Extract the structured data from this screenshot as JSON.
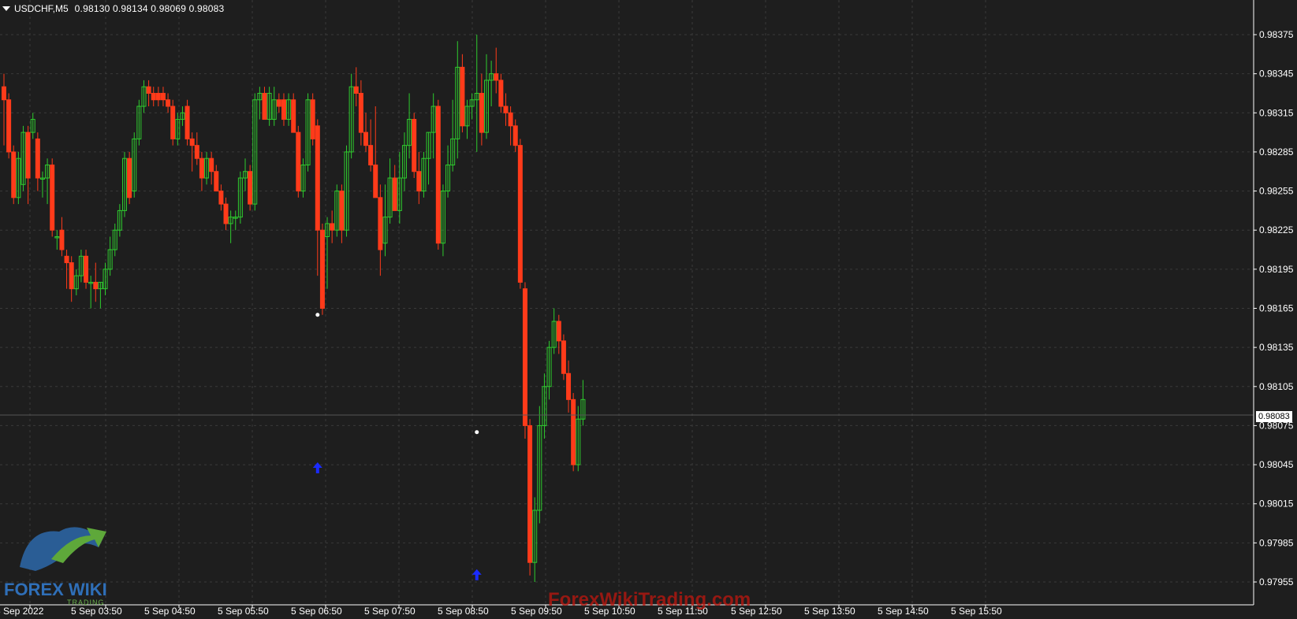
{
  "header": {
    "symbol": "USDCHF,M5",
    "quote": "0.98130 0.98134 0.98069 0.98083"
  },
  "price_axis": {
    "labels": [
      "0.98375",
      "0.98345",
      "0.98315",
      "0.98285",
      "0.98255",
      "0.98225",
      "0.98195",
      "0.98165",
      "0.98135",
      "0.98105",
      "0.98075",
      "0.98045",
      "0.98015",
      "0.97985",
      "0.97955"
    ],
    "current_price": "0.98083"
  },
  "time_axis": {
    "labels": [
      "5 Sep 2022",
      "5 Sep 03:50",
      "5 Sep 04:50",
      "5 Sep 05:50",
      "5 Sep 06:50",
      "5 Sep 07:50",
      "5 Sep 08:50",
      "5 Sep 09:50",
      "5 Sep 10:50",
      "5 Sep 11:50",
      "5 Sep 12:50",
      "5 Sep 13:50",
      "5 Sep 14:50",
      "5 Sep 15:50"
    ]
  },
  "colors": {
    "background": "#1e1e1e",
    "grid": "#3a3a3a",
    "bull": "#2ecc2e",
    "bear": "#ff3b1a",
    "axis_text": "#ffffff",
    "signal_arrow": "#1a2bff"
  },
  "watermark": "ForexWikiTrading.com",
  "logo": {
    "text": "FOREX WIKI",
    "sub": "TRADING"
  },
  "signals": [
    {
      "type": "arrow-up",
      "bar_index": 65,
      "price": 0.98042
    },
    {
      "type": "arrow-up",
      "bar_index": 98,
      "price": 0.9796
    }
  ],
  "dots": [
    {
      "bar_index": 65,
      "price": 0.9816
    },
    {
      "bar_index": 98,
      "price": 0.9807
    }
  ],
  "candles": [
    [
      0.98335,
      0.98345,
      0.9829,
      0.98325
    ],
    [
      0.98325,
      0.9833,
      0.9828,
      0.98285
    ],
    [
      0.98285,
      0.9829,
      0.98245,
      0.9825
    ],
    [
      0.9825,
      0.98285,
      0.98245,
      0.9828
    ],
    [
      0.9826,
      0.98305,
      0.98255,
      0.983
    ],
    [
      0.983,
      0.98305,
      0.98245,
      0.98265
    ],
    [
      0.983,
      0.98315,
      0.98295,
      0.9831
    ],
    [
      0.98295,
      0.983,
      0.98255,
      0.98265
    ],
    [
      0.98265,
      0.9827,
      0.9825,
      0.98265
    ],
    [
      0.98265,
      0.9828,
      0.98245,
      0.98275
    ],
    [
      0.98275,
      0.9828,
      0.9822,
      0.98225
    ],
    [
      0.9822,
      0.98225,
      0.9821,
      0.9822
    ],
    [
      0.98225,
      0.98235,
      0.98205,
      0.9821
    ],
    [
      0.98205,
      0.9821,
      0.9818,
      0.982
    ],
    [
      0.982,
      0.98205,
      0.9817,
      0.9818
    ],
    [
      0.9818,
      0.98195,
      0.98175,
      0.9819
    ],
    [
      0.9819,
      0.9821,
      0.98185,
      0.98205
    ],
    [
      0.98205,
      0.9821,
      0.9818,
      0.98185
    ],
    [
      0.98185,
      0.9819,
      0.98165,
      0.98185
    ],
    [
      0.98185,
      0.982,
      0.9817,
      0.9818
    ],
    [
      0.9818,
      0.98185,
      0.98165,
      0.98185
    ],
    [
      0.9818,
      0.982,
      0.98175,
      0.98195
    ],
    [
      0.98195,
      0.9822,
      0.9819,
      0.9821
    ],
    [
      0.9821,
      0.9823,
      0.98205,
      0.98225
    ],
    [
      0.98225,
      0.98245,
      0.9822,
      0.9824
    ],
    [
      0.9824,
      0.98285,
      0.98235,
      0.9828
    ],
    [
      0.9828,
      0.98285,
      0.98245,
      0.9825
    ],
    [
      0.98255,
      0.983,
      0.9825,
      0.98295
    ],
    [
      0.98295,
      0.98325,
      0.9829,
      0.9832
    ],
    [
      0.9832,
      0.9834,
      0.98315,
      0.98335
    ],
    [
      0.98335,
      0.9834,
      0.9832,
      0.9833
    ],
    [
      0.9833,
      0.98335,
      0.9832,
      0.98325
    ],
    [
      0.9833,
      0.98335,
      0.9832,
      0.98325
    ],
    [
      0.9833,
      0.98335,
      0.9832,
      0.98325
    ],
    [
      0.98325,
      0.9833,
      0.98315,
      0.9832
    ],
    [
      0.9832,
      0.98325,
      0.9829,
      0.98295
    ],
    [
      0.98295,
      0.98315,
      0.9829,
      0.9831
    ],
    [
      0.9831,
      0.9832,
      0.98305,
      0.98315
    ],
    [
      0.9832,
      0.98325,
      0.9829,
      0.98295
    ],
    [
      0.98295,
      0.983,
      0.9827,
      0.9829
    ],
    [
      0.9829,
      0.983,
      0.98275,
      0.9828
    ],
    [
      0.9828,
      0.98285,
      0.98255,
      0.98265
    ],
    [
      0.98265,
      0.98285,
      0.9826,
      0.9828
    ],
    [
      0.9828,
      0.98285,
      0.9826,
      0.9827
    ],
    [
      0.9827,
      0.98275,
      0.98255,
      0.98255
    ],
    [
      0.98255,
      0.9826,
      0.9824,
      0.98245
    ],
    [
      0.98245,
      0.9825,
      0.98225,
      0.9823
    ],
    [
      0.9823,
      0.9824,
      0.98215,
      0.98235
    ],
    [
      0.98235,
      0.9824,
      0.98225,
      0.98235
    ],
    [
      0.98235,
      0.9827,
      0.9823,
      0.98265
    ],
    [
      0.98265,
      0.9828,
      0.98255,
      0.9827
    ],
    [
      0.9827,
      0.98275,
      0.9824,
      0.98245
    ],
    [
      0.98245,
      0.9833,
      0.9824,
      0.98325
    ],
    [
      0.98325,
      0.98335,
      0.9831,
      0.9833
    ],
    [
      0.9833,
      0.98335,
      0.9831,
      0.9831
    ],
    [
      0.9831,
      0.98335,
      0.98305,
      0.9833
    ],
    [
      0.9831,
      0.98335,
      0.98305,
      0.98325
    ],
    [
      0.98325,
      0.9833,
      0.98315,
      0.9832
    ],
    [
      0.98325,
      0.9833,
      0.98305,
      0.9831
    ],
    [
      0.9831,
      0.9833,
      0.98305,
      0.98325
    ],
    [
      0.98325,
      0.9833,
      0.983,
      0.983
    ],
    [
      0.983,
      0.98305,
      0.9825,
      0.98255
    ],
    [
      0.98255,
      0.9828,
      0.9825,
      0.98275
    ],
    [
      0.98275,
      0.9833,
      0.9827,
      0.98325
    ],
    [
      0.98325,
      0.9833,
      0.9829,
      0.98295
    ],
    [
      0.98305,
      0.9831,
      0.9819,
      0.98225
    ],
    [
      0.98225,
      0.9823,
      0.9816,
      0.98165
    ],
    [
      0.9822,
      0.98235,
      0.9818,
      0.9823
    ],
    [
      0.9823,
      0.9824,
      0.98215,
      0.98225
    ],
    [
      0.98225,
      0.9826,
      0.9822,
      0.98255
    ],
    [
      0.98255,
      0.9826,
      0.98215,
      0.98225
    ],
    [
      0.98225,
      0.9829,
      0.9822,
      0.98285
    ],
    [
      0.98285,
      0.98345,
      0.9828,
      0.98335
    ],
    [
      0.98335,
      0.9835,
      0.9832,
      0.9833
    ],
    [
      0.9833,
      0.9834,
      0.9829,
      0.983
    ],
    [
      0.983,
      0.98315,
      0.98285,
      0.9829
    ],
    [
      0.9829,
      0.9831,
      0.9827,
      0.98275
    ],
    [
      0.98275,
      0.9832,
      0.9825,
      0.9825
    ],
    [
      0.9825,
      0.9826,
      0.9819,
      0.9821
    ],
    [
      0.98215,
      0.9826,
      0.98205,
      0.98235
    ],
    [
      0.98235,
      0.9828,
      0.9823,
      0.98265
    ],
    [
      0.98265,
      0.98275,
      0.9824,
      0.9824
    ],
    [
      0.9824,
      0.98285,
      0.9823,
      0.98265
    ],
    [
      0.98265,
      0.983,
      0.98255,
      0.9829
    ],
    [
      0.9829,
      0.9833,
      0.9828,
      0.9831
    ],
    [
      0.9831,
      0.98315,
      0.98265,
      0.9827
    ],
    [
      0.9827,
      0.98285,
      0.98245,
      0.98255
    ],
    [
      0.98255,
      0.98285,
      0.9825,
      0.9828
    ],
    [
      0.9828,
      0.983,
      0.9826,
      0.983
    ],
    [
      0.983,
      0.9833,
      0.9828,
      0.9832
    ],
    [
      0.9832,
      0.98325,
      0.9821,
      0.98215
    ],
    [
      0.98215,
      0.9826,
      0.98205,
      0.98255
    ],
    [
      0.98255,
      0.9829,
      0.9825,
      0.98275
    ],
    [
      0.98275,
      0.98325,
      0.9827,
      0.98295
    ],
    [
      0.98295,
      0.9837,
      0.9828,
      0.9835
    ],
    [
      0.9835,
      0.9836,
      0.983,
      0.98305
    ],
    [
      0.98305,
      0.98325,
      0.98295,
      0.9832
    ],
    [
      0.9832,
      0.9833,
      0.9831,
      0.98325
    ],
    [
      0.98325,
      0.98375,
      0.98285,
      0.9833
    ],
    [
      0.9833,
      0.98345,
      0.9829,
      0.983
    ],
    [
      0.983,
      0.9836,
      0.98295,
      0.9834
    ],
    [
      0.9834,
      0.98355,
      0.9832,
      0.98345
    ],
    [
      0.98345,
      0.98365,
      0.9833,
      0.9834
    ],
    [
      0.9834,
      0.98345,
      0.98315,
      0.9832
    ],
    [
      0.9832,
      0.9833,
      0.98305,
      0.98315
    ],
    [
      0.98315,
      0.9832,
      0.9829,
      0.98305
    ],
    [
      0.98305,
      0.9831,
      0.98285,
      0.9829
    ],
    [
      0.9829,
      0.98295,
      0.9818,
      0.98185
    ],
    [
      0.9818,
      0.98185,
      0.98065,
      0.98075
    ],
    [
      0.98075,
      0.9808,
      0.9796,
      0.9797
    ],
    [
      0.9797,
      0.9802,
      0.97955,
      0.9801
    ],
    [
      0.9801,
      0.9809,
      0.98,
      0.98075
    ],
    [
      0.98075,
      0.98115,
      0.98065,
      0.98105
    ],
    [
      0.98105,
      0.9814,
      0.98095,
      0.98135
    ],
    [
      0.98135,
      0.98165,
      0.9813,
      0.98155
    ],
    [
      0.98155,
      0.9816,
      0.9813,
      0.9814
    ],
    [
      0.9814,
      0.98145,
      0.9811,
      0.98115
    ],
    [
      0.98115,
      0.98125,
      0.98085,
      0.98095
    ],
    [
      0.98095,
      0.981,
      0.9804,
      0.98045
    ],
    [
      0.98045,
      0.9809,
      0.9804,
      0.9808
    ],
    [
      0.9808,
      0.9811,
      0.98075,
      0.98095
    ]
  ]
}
